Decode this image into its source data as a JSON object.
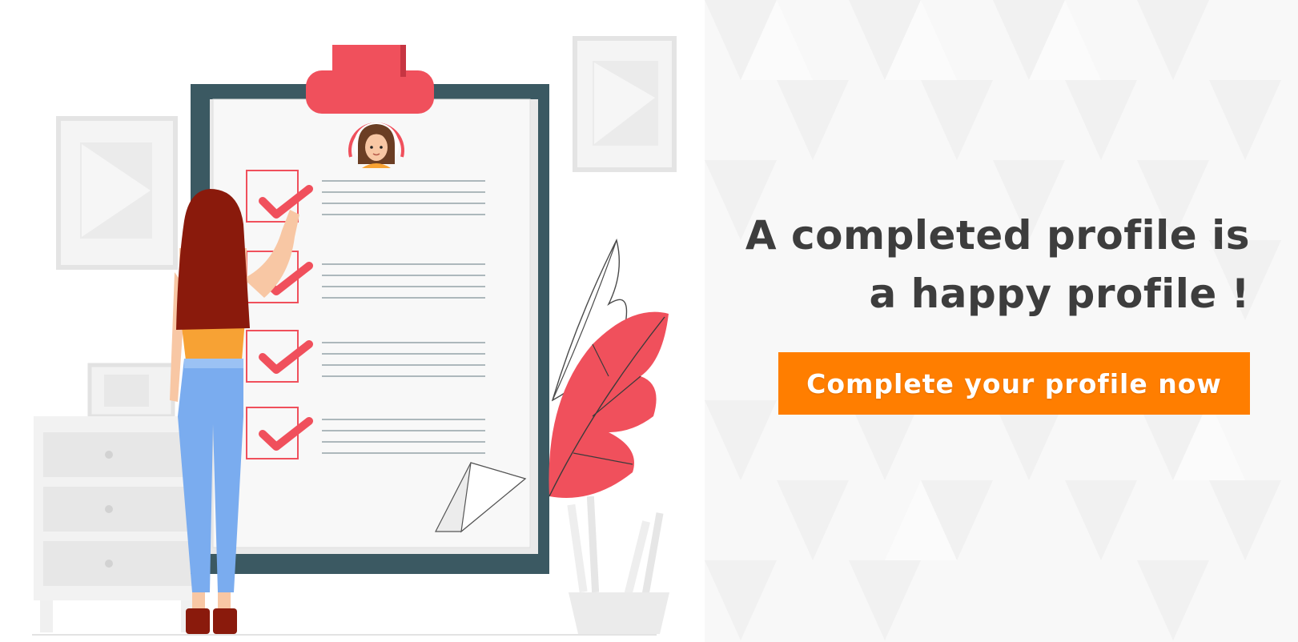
{
  "headline": {
    "line1": "A completed profile is",
    "line2": "a happy profile !"
  },
  "cta": {
    "label": "Complete your profile now"
  },
  "colors": {
    "accent_orange": "#ff7e00",
    "checklist_red": "#f0505c",
    "clipboard_board": "#3b5962",
    "hair": "#8a1a0c",
    "top": "#f7a234",
    "jeans": "#7aacef",
    "headline_text": "#3d3d3d"
  },
  "icons": {
    "avatar": "profile-avatar-icon",
    "check": "checkmark-icon"
  }
}
